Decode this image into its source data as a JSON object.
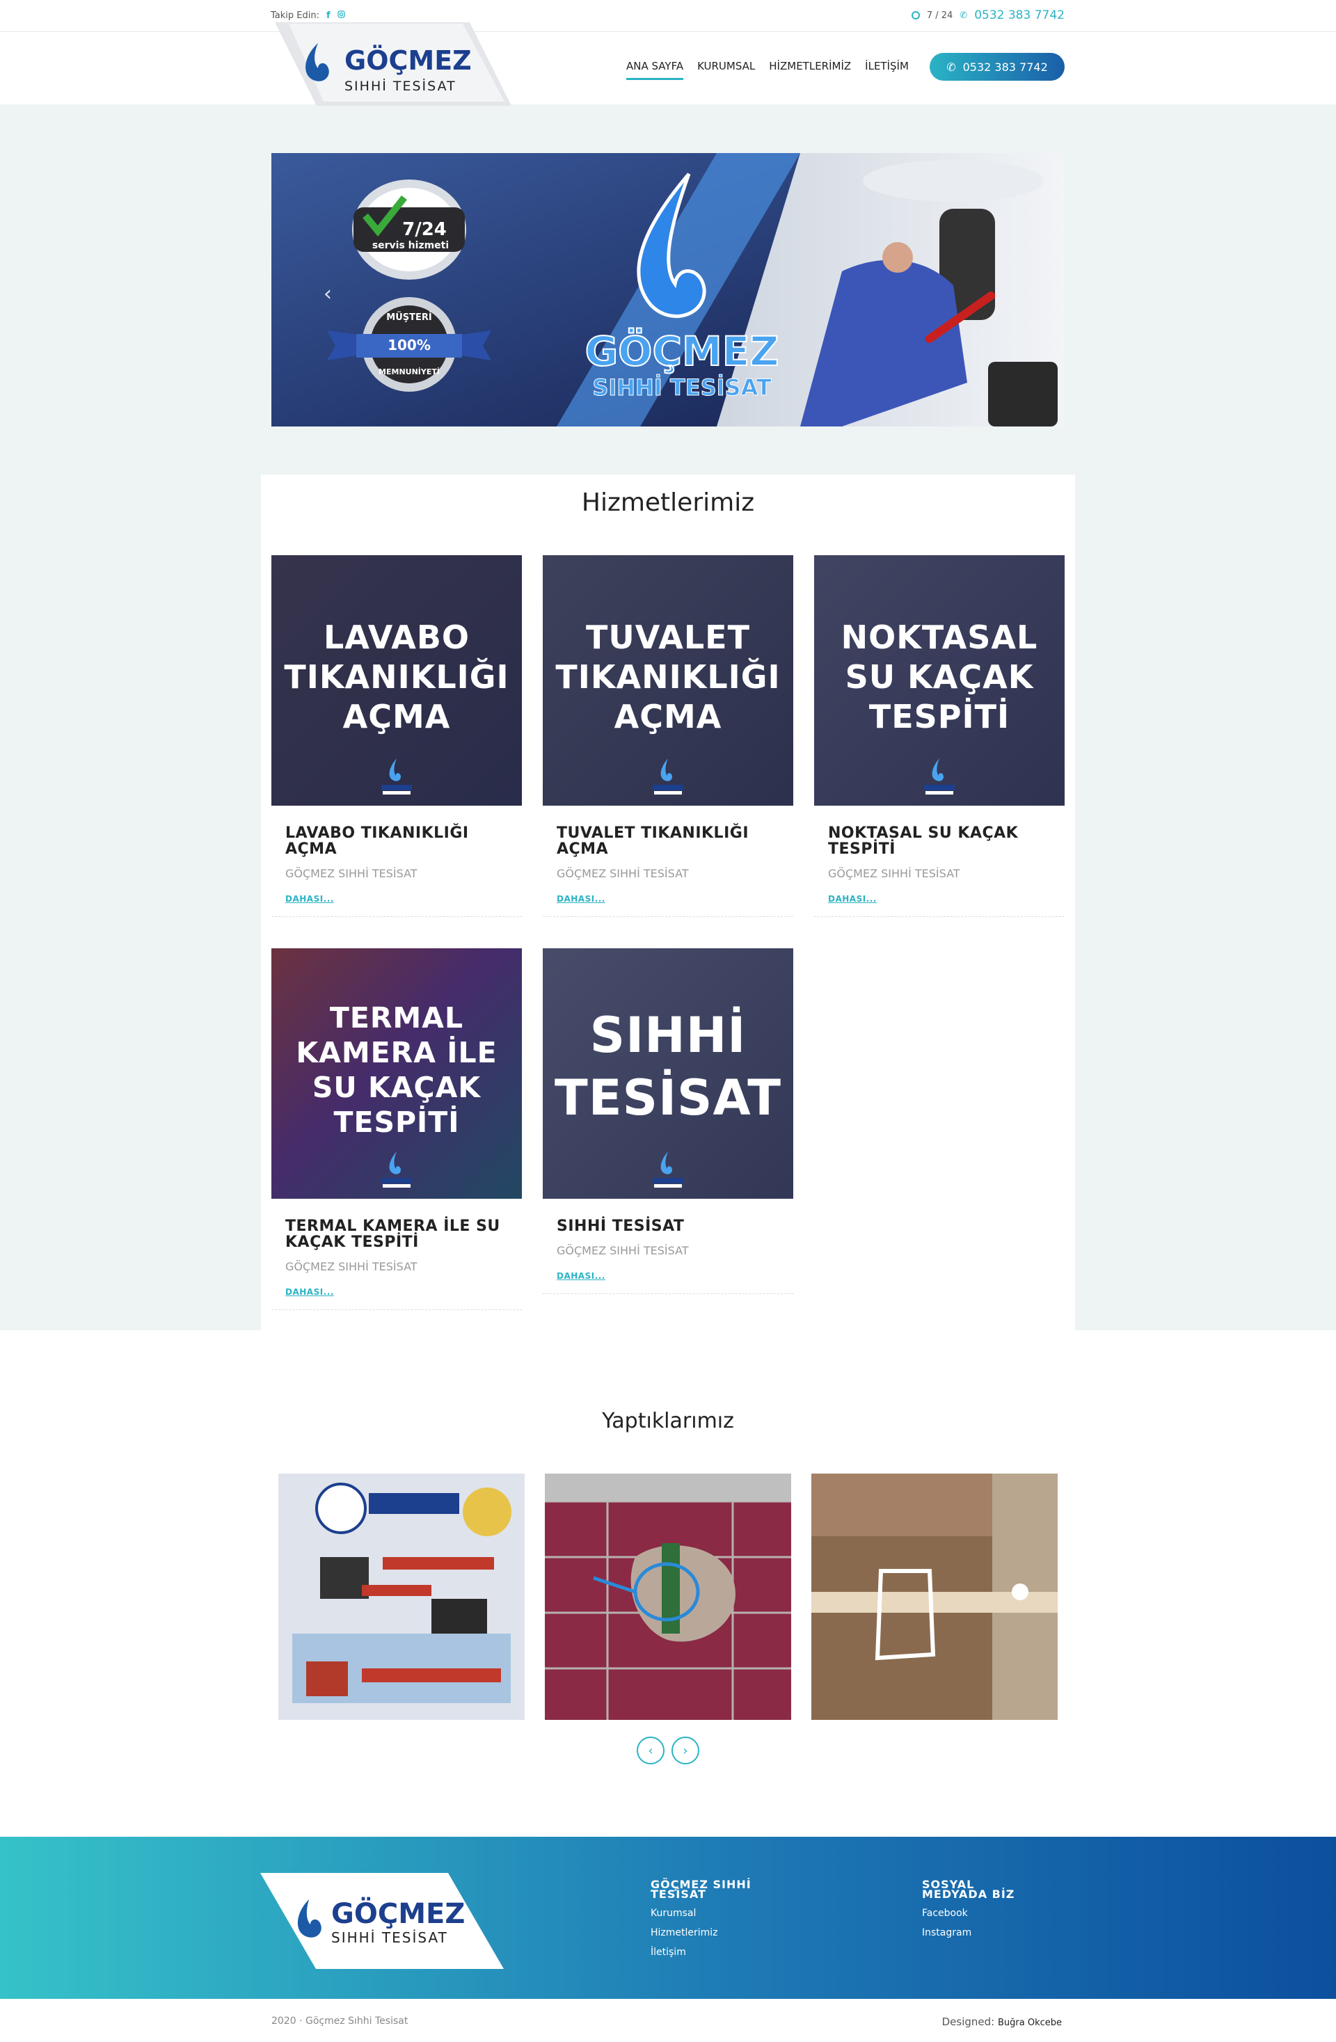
{
  "topbar": {
    "follow_label": "Takip Edin:",
    "hours": "7 / 24",
    "phone": "0532 383 7742"
  },
  "brand": {
    "name": "GÖÇMEZ",
    "tagline": "SIHHİ TESİSAT"
  },
  "nav": {
    "items": [
      "ANA SAYFA",
      "KURUMSAL",
      "HİZMETLERİMİZ",
      "İLETİŞİM"
    ],
    "call_button": "0532 383 7742"
  },
  "slider": {
    "badge_top_line1": "7/24",
    "badge_top_line2": "servis hizmeti",
    "badge_bottom_line1": "MÜŞTERİ",
    "badge_bottom_line2": "100%",
    "badge_bottom_line3": "MEMNUNİYETİ",
    "logo_name": "GÖÇMEZ",
    "logo_tagline": "SIHHİ TESİSAT"
  },
  "services": {
    "title": "Hizmetlerimiz",
    "more_label": "DAHASI...",
    "items": [
      {
        "image_text": "LAVABO TIKANIKLIĞI AÇMA",
        "title": "LAVABO TIKANIKLIĞI AÇMA",
        "subtitle": "GÖÇMEZ SIHHİ TESİSAT"
      },
      {
        "image_text": "TUVALET TIKANIKLIĞI AÇMA",
        "title": "TUVALET TIKANIKLIĞI AÇMA",
        "subtitle": "GÖÇMEZ SIHHİ TESİSAT"
      },
      {
        "image_text": "NOKTASAL SU KAÇAK TESPİTİ",
        "title": "NOKTASAL SU KAÇAK TESPİTİ",
        "subtitle": "GÖÇMEZ SIHHİ TESİSAT"
      },
      {
        "image_text": "TERMAL KAMERA İLE SU KAÇAK TESPİTİ",
        "title": "TERMAL KAMERA İLE SU KAÇAK TESPİTİ",
        "subtitle": "GÖÇMEZ SIHHİ TESİSAT"
      },
      {
        "image_text": "SIHHİ TESİSAT",
        "title": "SIHHİ TESİSAT",
        "subtitle": "GÖÇMEZ SIHHİ TESİSAT"
      }
    ]
  },
  "works": {
    "title": "Yaptıklarımız",
    "prev": "‹",
    "next": "›"
  },
  "footer": {
    "col1_title": "GÖÇMEZ SIHHİ TESİSAT",
    "col1_links": [
      "Kurumsal",
      "Hizmetlerimiz",
      "İletişim"
    ],
    "col2_title": "SOSYAL MEDYADA BİZ",
    "col2_links": [
      "Facebook",
      "Instagram"
    ],
    "copyright": "2020 · Göçmez Sıhhi Tesisat",
    "designed_label": "Designed:",
    "designer": "Buğra Okcebe"
  }
}
